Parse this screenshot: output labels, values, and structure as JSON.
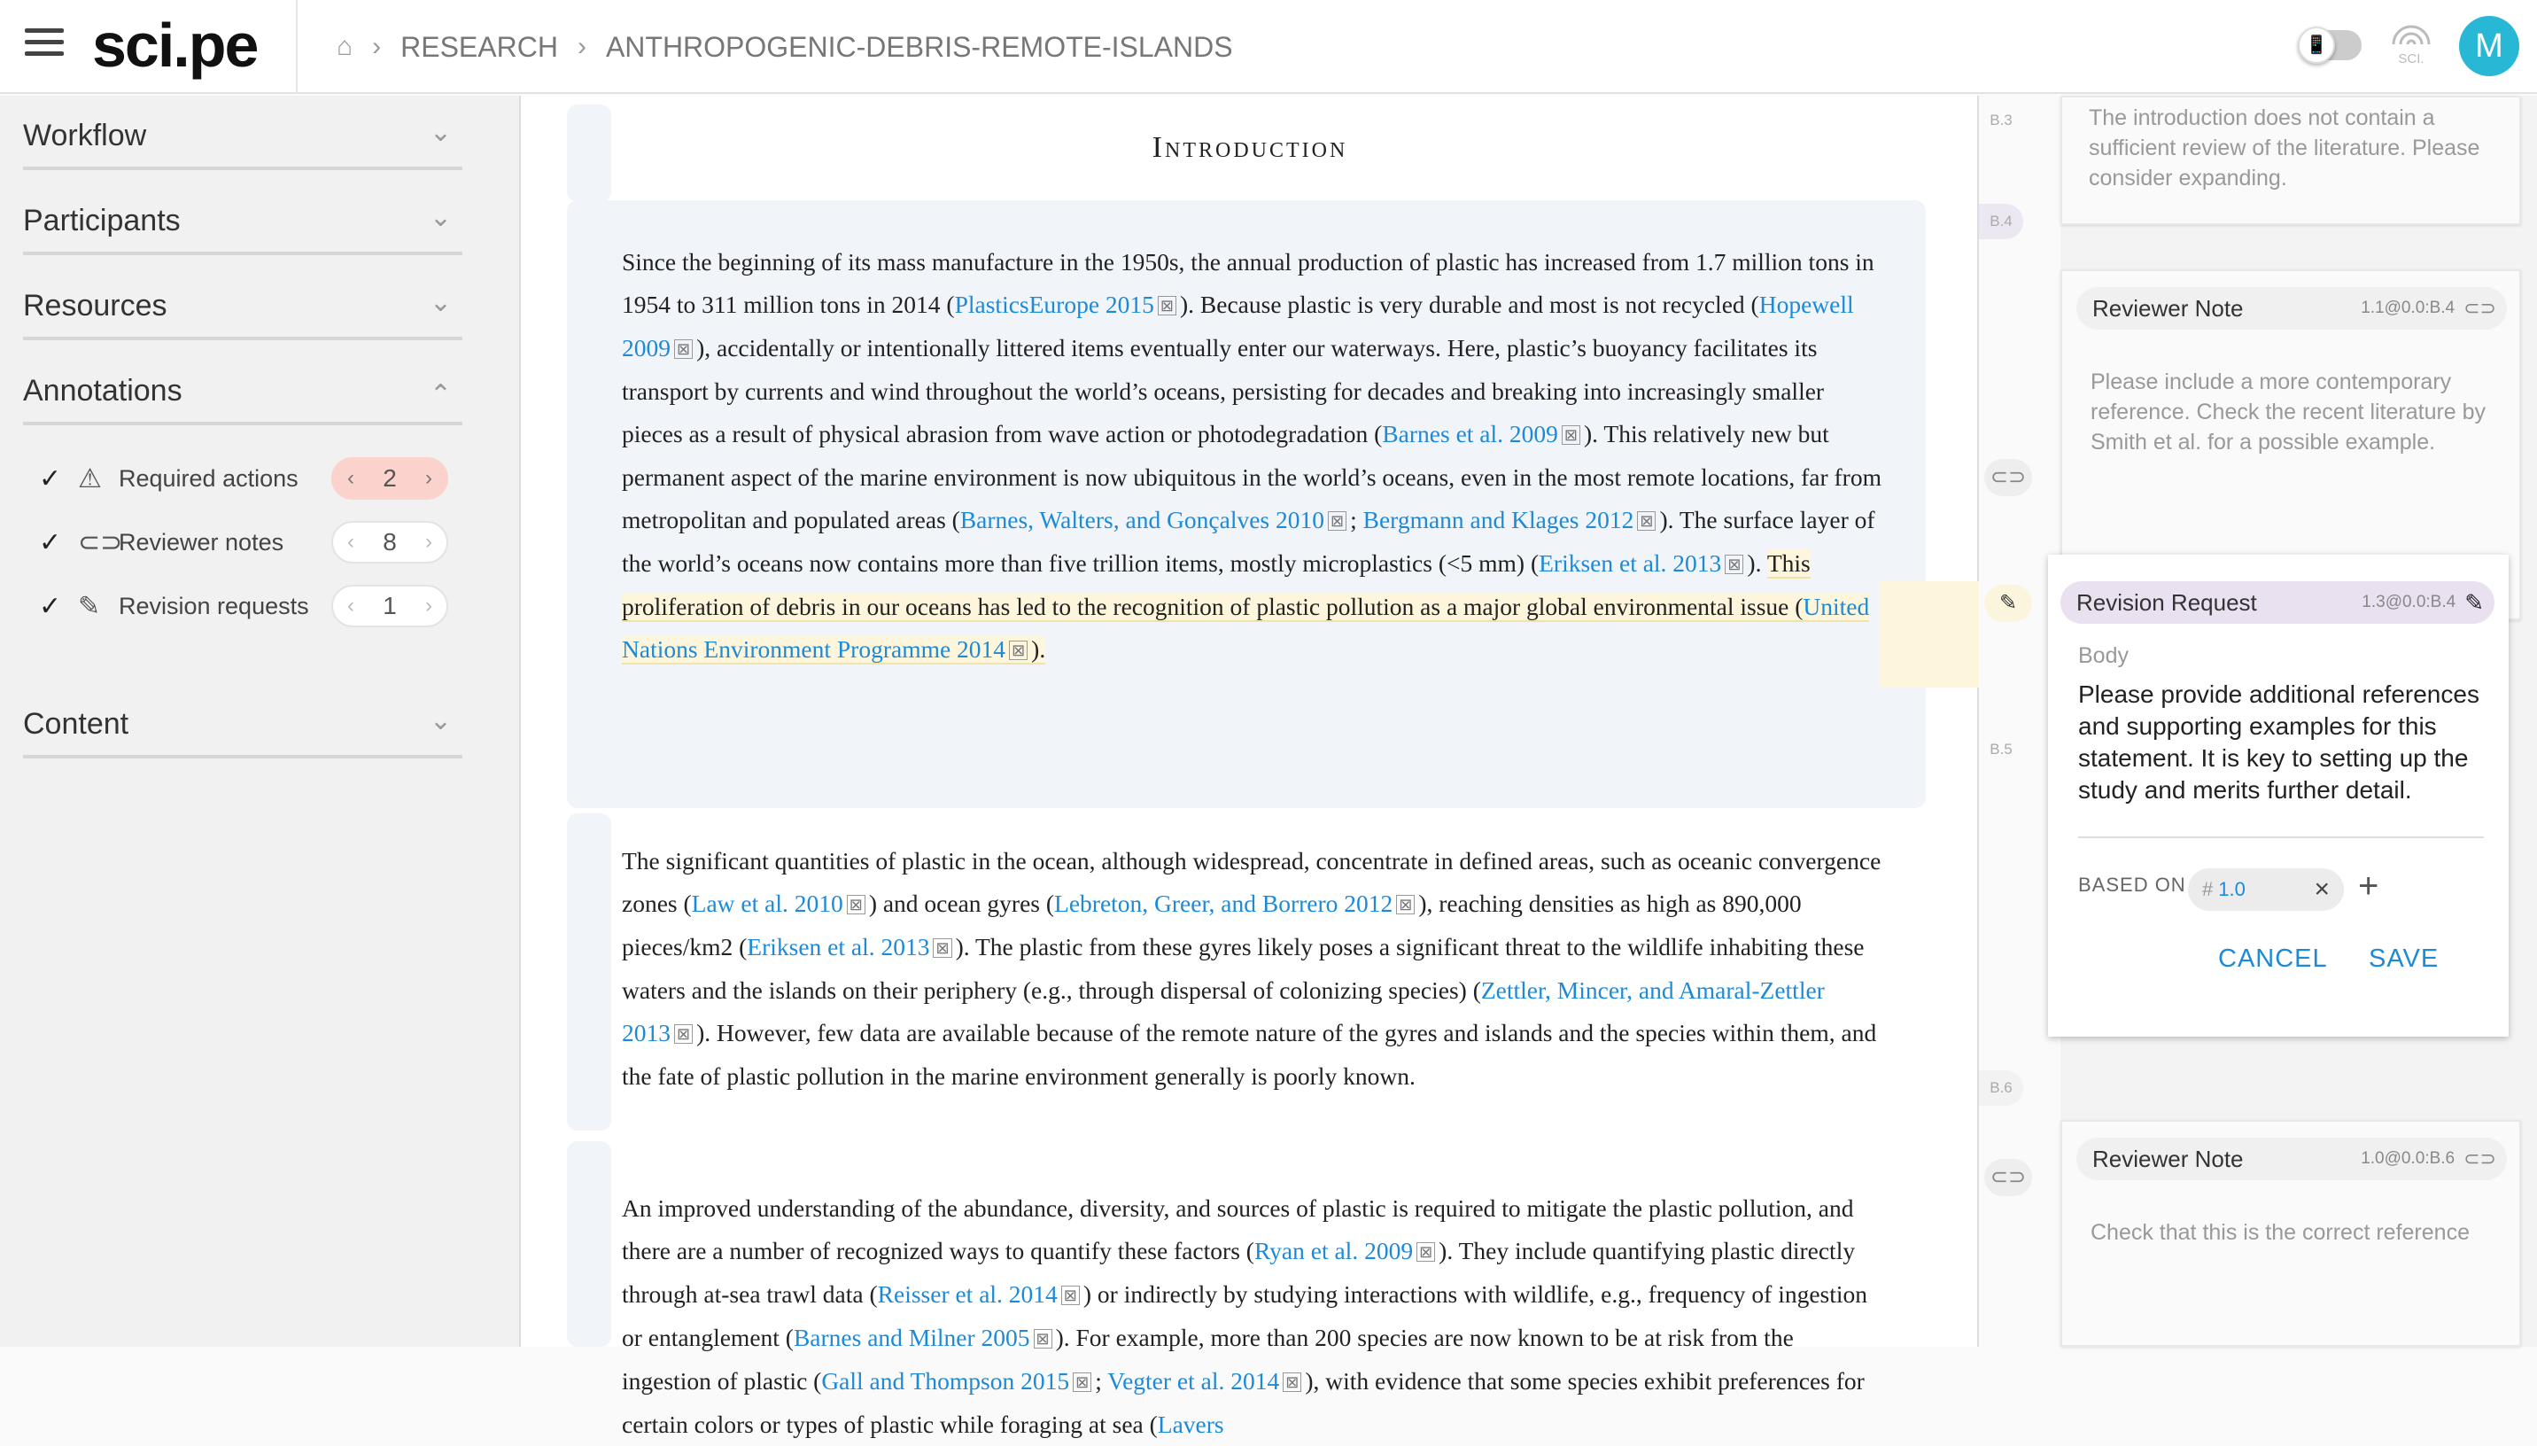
{
  "header": {
    "logo": "sci.pe",
    "breadcrumbs": [
      "RESEARCH",
      "ANTHROPOGENIC-DEBRIS-REMOTE-ISLANDS"
    ],
    "toggle_icon": "📱",
    "sci_label": "SCI.",
    "avatar_initial": "M"
  },
  "sidebar": {
    "sections": [
      "Workflow",
      "Participants",
      "Resources",
      "Annotations",
      "Content"
    ],
    "annotations": [
      {
        "label": "Required actions",
        "count": "2"
      },
      {
        "label": "Reviewer notes",
        "count": "8"
      },
      {
        "label": "Revision requests",
        "count": "1"
      }
    ]
  },
  "document": {
    "heading": "Introduction",
    "p1": {
      "t1": "Since the beginning of its mass manufacture in the 1950s, the annual production of plastic has increased from 1.7 million tons in 1954 to 311 million tons in 2014 (",
      "l1": "PlasticsEurope 2015",
      "t2": "). Because plastic is very durable and most is not recycled (",
      "l2": "Hopewell 2009",
      "t3": "), accidentally or intentionally littered items eventually enter our waterways. Here, plastic’s buoyancy facilitates its transport by currents and wind throughout the world’s oceans, persisting for decades and breaking into increasingly smaller pieces as a result of physical abrasion from wave action or photodegradation (",
      "l3": "Barnes et al. 2009",
      "t4": "). This relatively new but permanent aspect of the marine environment is now ubiquitous in the world’s oceans, even in the most remote locations, far from metropolitan and populated areas (",
      "l4": "Barnes, Walters, and Gonçalves 2010",
      "t5": "; ",
      "l5": "Bergmann and Klages 2012",
      "t6": "). The surface layer of the world’s oceans now contains more than five trillion items, mostly microplastics (<5 mm) (",
      "l6": "Eriksen et al. 2013",
      "t7": "). ",
      "h1": "This proliferation of debris in our oceans has led to the recognition of plastic pollution as a major global environmental issue (",
      "l7": "United Nations Environment Programme 2014",
      "t8": ")."
    },
    "p2": {
      "t1": "The significant quantities of plastic in the ocean, although widespread, concentrate in defined areas, such as oceanic convergence zones (",
      "l1": "Law et al. 2010",
      "t2": ") and ocean gyres (",
      "l2": "Lebreton, Greer, and Borrero 2012",
      "t3": "), reaching densities as high as 890,000 pieces/km2 (",
      "l3": "Eriksen et al. 2013",
      "t4": "). The plastic from these gyres likely poses a significant threat to the wildlife inhabiting these waters and the islands on their periphery (e.g., through dispersal of colonizing species) (",
      "l4": "Zettler, Mincer, and Amaral-Zettler 2013",
      "t5": "). However, few data are available because of the remote nature of the gyres and islands and the species within them, and the fate of plastic pollution in the marine environment generally is poorly known."
    },
    "p3": {
      "t1": "An improved understanding of the abundance, diversity, and sources of plastic is required to mitigate the plastic pollution, and there are a number of recognized ways to quantify these factors (",
      "l1": "Ryan et al. 2009",
      "t2": "). They include quantifying plastic directly through at-sea trawl data (",
      "l2": "Reisser et al. 2014",
      "t3": ") or indirectly by studying interactions with wildlife, e.g., frequency of ingestion or entanglement (",
      "l3": "Barnes and Milner 2005",
      "t4": "). For example, more than 200 species are now known to be at risk from the ingestion of plastic (",
      "l4": "Gall and Thompson 2015",
      "t5": "; ",
      "l5": "Vegter et al. 2014",
      "t6": "), with evidence that some species exhibit preferences for certain colors or types of plastic while foraging at sea (",
      "l6": "Lavers"
    }
  },
  "margin": {
    "labels": [
      "B.3",
      "B.4",
      "B.5",
      "B.6"
    ]
  },
  "comments": {
    "c0": {
      "body": "The introduction does not contain a sufficient review of the literature. Please consider expanding."
    },
    "c1": {
      "label": "Reviewer Note",
      "meta": "1.1@0.0:B.4",
      "body": "Please include a more contemporary reference. Check the recent literature by Smith et al. for a possible example."
    },
    "rr": {
      "label": "Revision Request",
      "meta": "1.3@0.0:B.4",
      "body_label": "Body",
      "body": "Please provide additional references and supporting examples for this statement. It is key to setting up the study and merits further detail.",
      "based_on_label": "BASED ON",
      "chip_hash": "#",
      "chip_value": "1.0",
      "cancel": "CANCEL",
      "save": "SAVE"
    },
    "c2": {
      "label": "Reviewer Note",
      "meta": "1.0@0.0:B.6",
      "body": "Check that this is the correct reference"
    }
  }
}
